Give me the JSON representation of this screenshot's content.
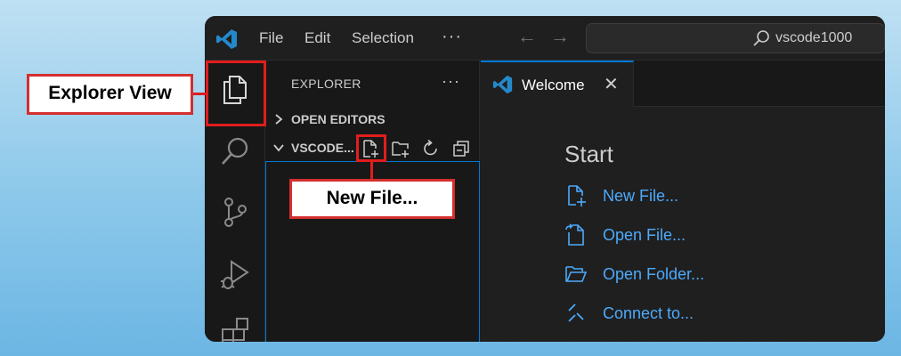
{
  "titlebar": {
    "menu": [
      "File",
      "Edit",
      "Selection"
    ],
    "more": "···",
    "back_arrow": "←",
    "forward_arrow": "→",
    "search_text": "vscode1000"
  },
  "activitybar": {
    "icons": [
      "files-icon",
      "search-icon",
      "source-control-icon",
      "run-debug-icon",
      "extensions-icon"
    ]
  },
  "sidebar": {
    "title": "EXPLORER",
    "more": "···",
    "open_editors": "OPEN EDITORS",
    "folder": "VSCODE...",
    "actions": [
      "new-file-icon",
      "new-folder-icon",
      "refresh-icon",
      "collapse-all-icon"
    ]
  },
  "editor": {
    "tab_label": "Welcome",
    "tab_close": "✕",
    "start_title": "Start",
    "start_items": [
      "New File...",
      "Open File...",
      "Open Folder...",
      "Connect to..."
    ]
  },
  "annotations": {
    "explorer_view": "Explorer View",
    "new_file": "New File..."
  },
  "colors": {
    "accent": "#0078d4",
    "link": "#4daafc",
    "callout_border": "#d32f2f",
    "vscode_blue": "#2489ca"
  }
}
